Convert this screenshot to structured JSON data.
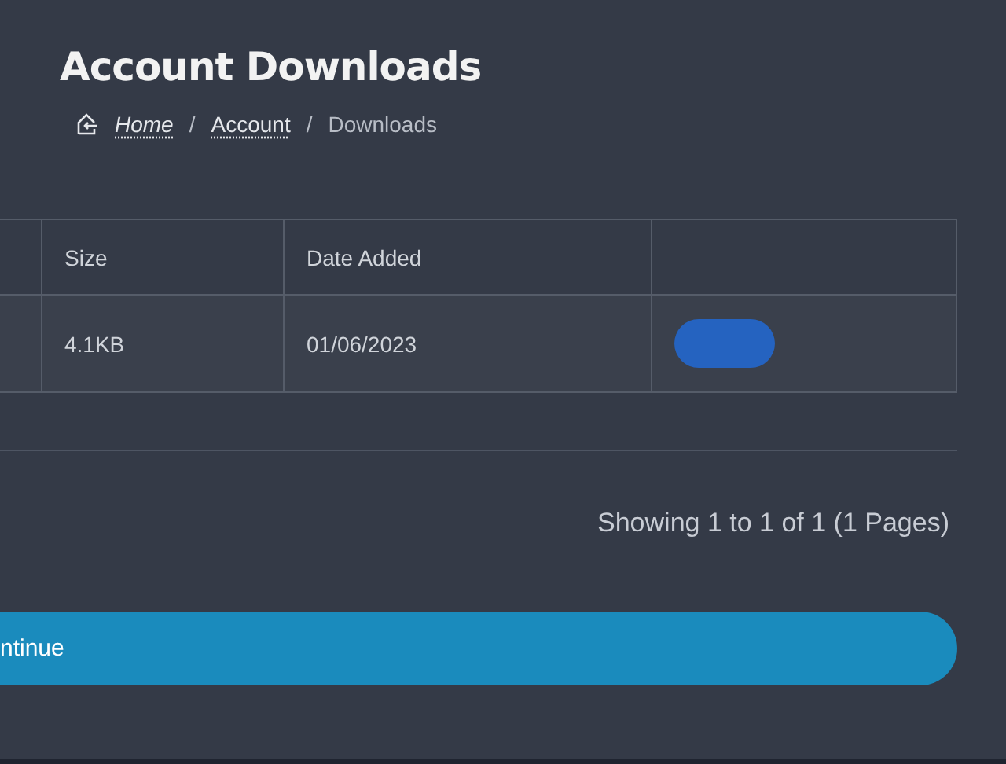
{
  "page": {
    "title": "Account Downloads"
  },
  "breadcrumb": [
    {
      "label": "Home",
      "kind": "home"
    },
    {
      "label": "Account",
      "kind": "link",
      "separator": "/"
    },
    {
      "label": "Downloads",
      "kind": "current",
      "separator": "/"
    }
  ],
  "table": {
    "columns": [
      "",
      "Size",
      "Date Added",
      ""
    ],
    "rows": [
      {
        "cells": [
          "",
          "4.1KB",
          "01/06/2023"
        ]
      }
    ]
  },
  "pagination": {
    "summary": "Showing 1 to 1 of 1 (1 Pages)"
  },
  "continue_button": {
    "label": "ntinue"
  }
}
